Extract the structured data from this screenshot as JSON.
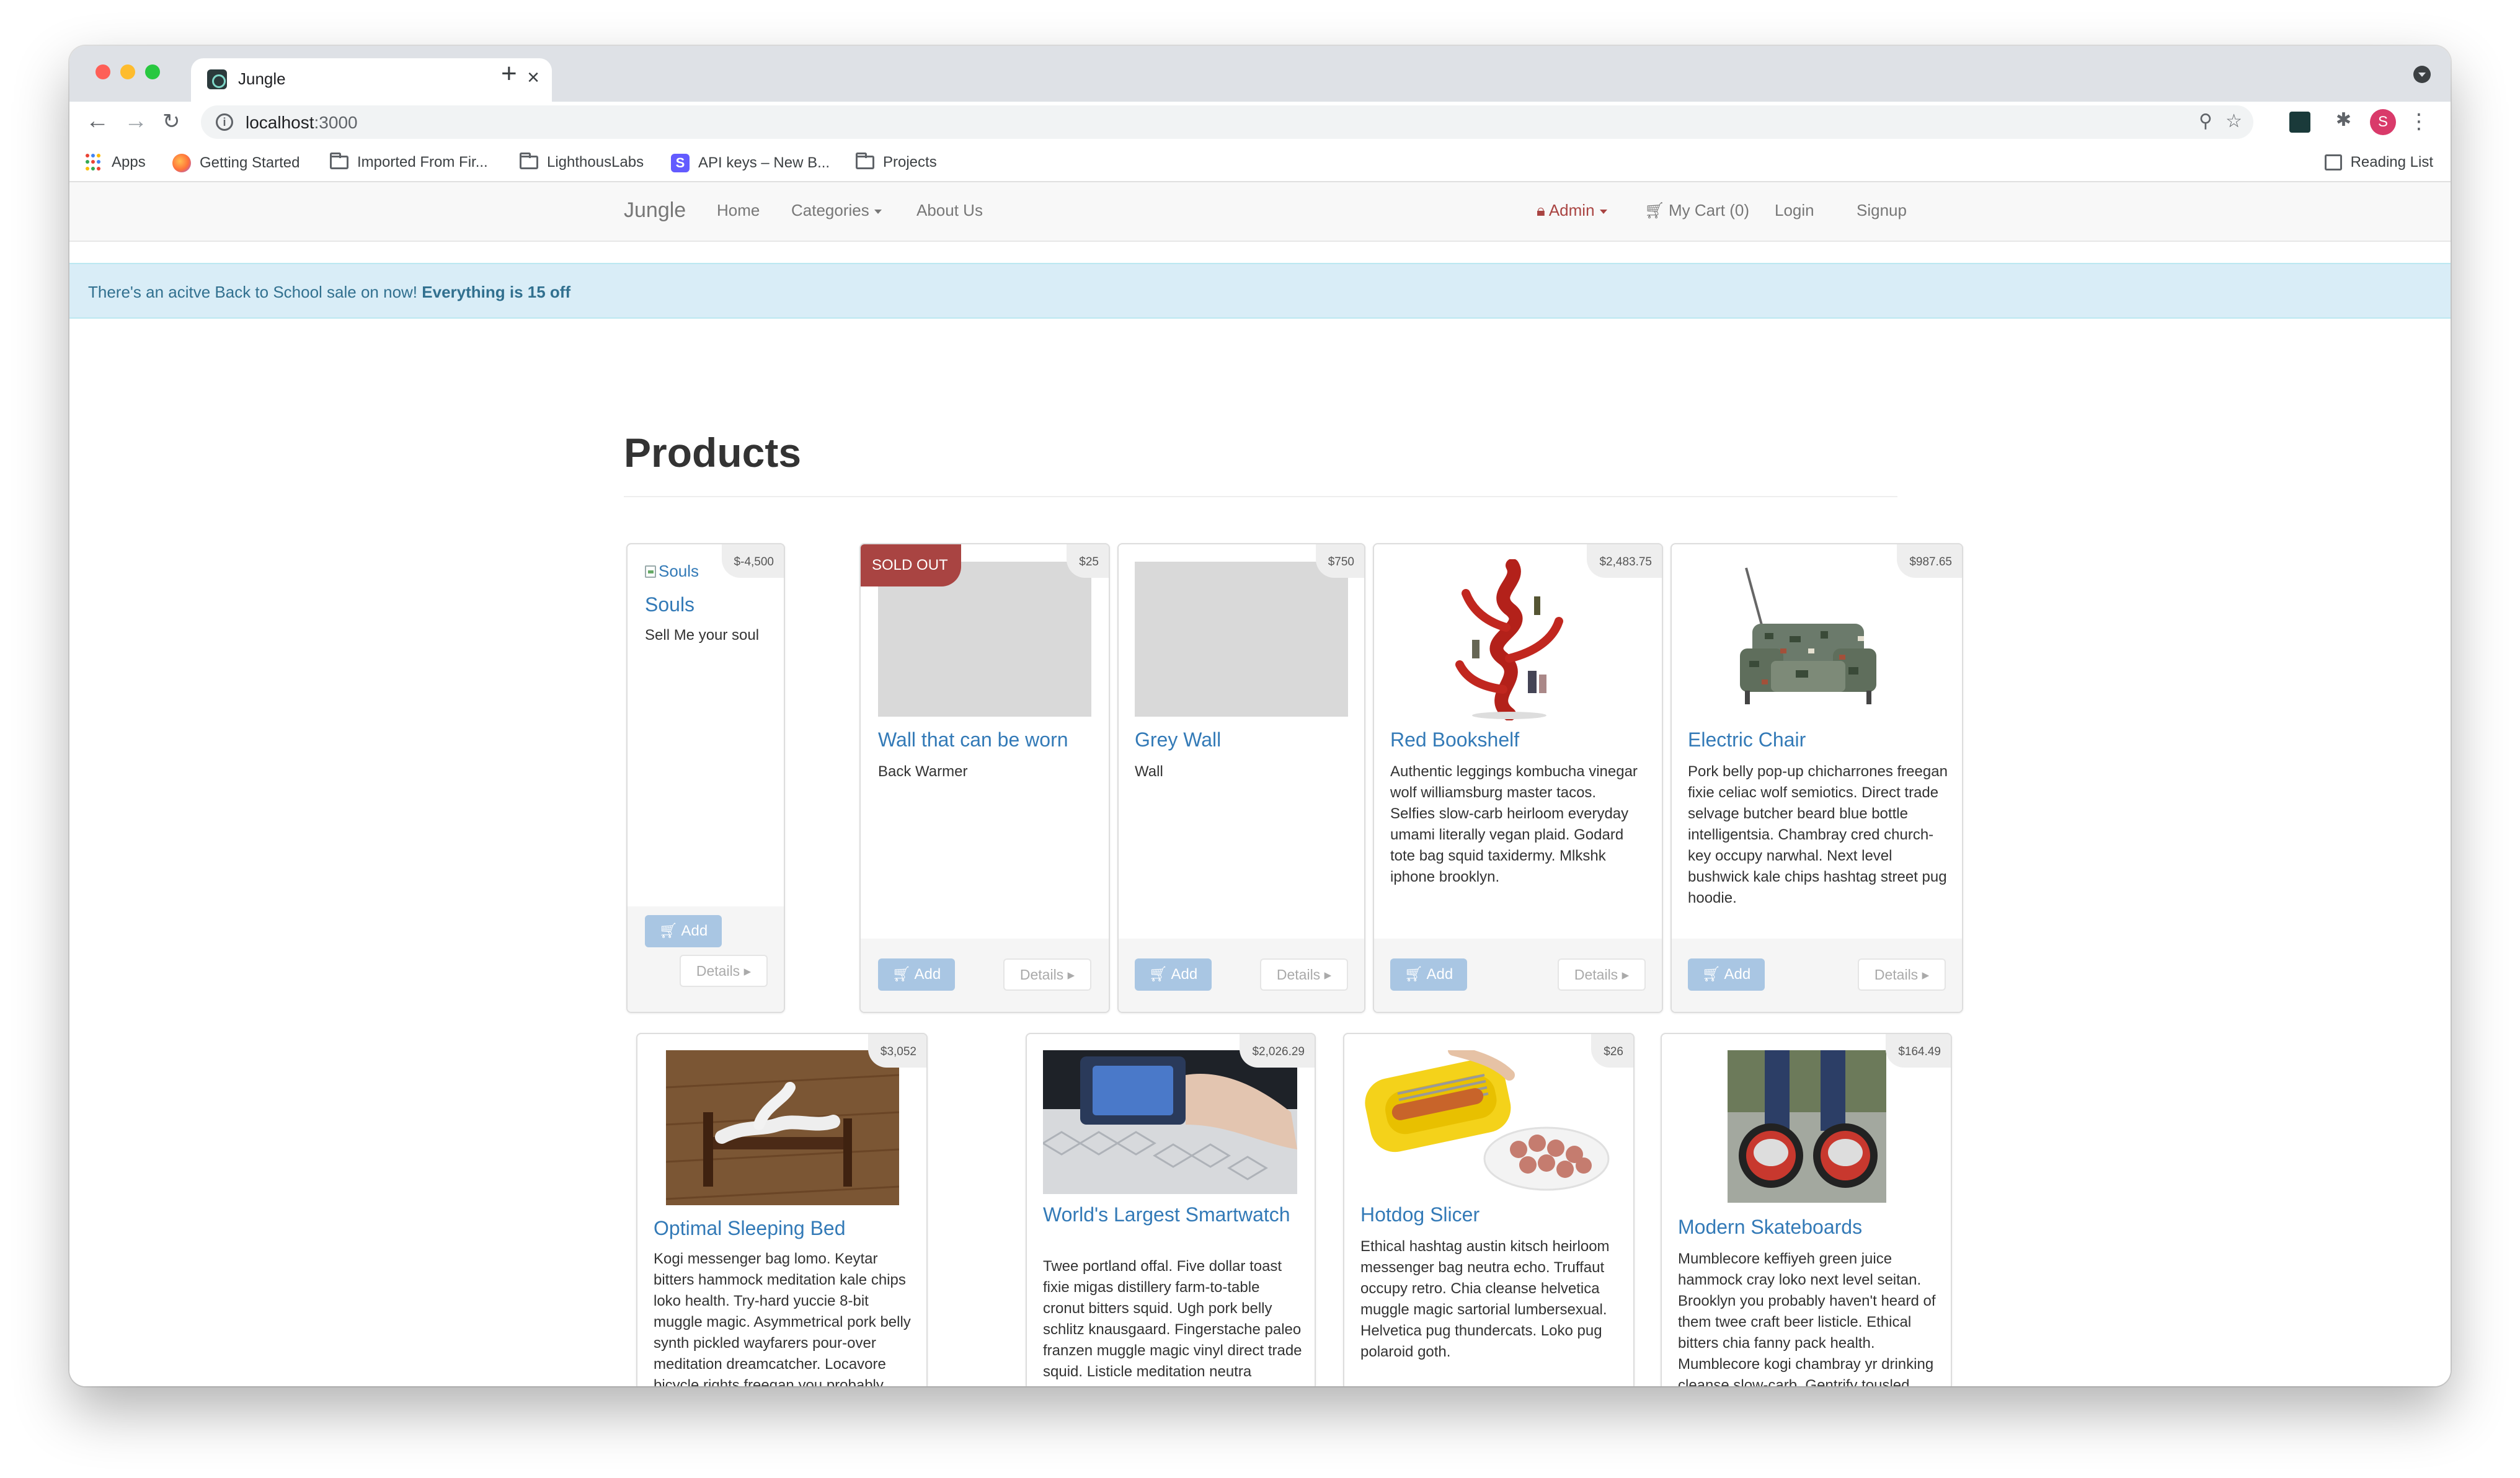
{
  "browser": {
    "tab_title": "Jungle",
    "url_host": "localhost",
    "url_port": ":3000",
    "bookmarks": [
      "Apps",
      "Getting Started",
      "Imported From Fir...",
      "LighthousLabs",
      "API keys – New B...",
      "Projects"
    ],
    "reading_list": "Reading List",
    "profile_initial": "S"
  },
  "nav": {
    "brand": "Jungle",
    "home": "Home",
    "categories": "Categories",
    "about": "About Us",
    "admin": "Admin",
    "cart": "My Cart (0)",
    "login": "Login",
    "signup": "Signup"
  },
  "alert": {
    "text": "There's an acitve Back to School sale on now! ",
    "bold": "Everything is 15 off"
  },
  "page": {
    "title": "Products"
  },
  "buttons": {
    "add": "Add",
    "details": "Details"
  },
  "products": [
    {
      "name": "Souls",
      "price": "$-4,500",
      "description": "Sell Me your soul",
      "image_alt": "Souls",
      "sold_out": false
    },
    {
      "name": "Wall that can be worn",
      "price": "$25",
      "description": "Back Warmer",
      "sold_out": true,
      "sold_out_label": "SOLD OUT"
    },
    {
      "name": "Grey Wall",
      "price": "$750",
      "description": "Wall",
      "sold_out": false
    },
    {
      "name": "Red Bookshelf",
      "price": "$2,483.75",
      "description": "Authentic leggings kombucha vinegar wolf williamsburg master tacos. Selfies slow-carb heirloom everyday umami literally vegan plaid. Godard tote bag squid taxidermy. Mlkshk iphone brooklyn.",
      "sold_out": false
    },
    {
      "name": "Electric Chair",
      "price": "$987.65",
      "description": "Pork belly pop-up chicharrones freegan fixie celiac wolf semiotics. Direct trade selvage butcher beard blue bottle intelligentsia. Chambray cred church-key occupy narwhal. Next level bushwick kale chips hashtag street pug hoodie.",
      "sold_out": false
    },
    {
      "name": "Optimal Sleeping Bed",
      "price": "$3,052",
      "description": "Kogi messenger bag lomo. Keytar bitters hammock meditation kale chips loko health. Try-hard yuccie 8-bit muggle magic. Asymmetrical pork belly synth pickled wayfarers pour-over meditation dreamcatcher. Locavore bicycle rights freegan you probably haven't heard of them.",
      "sold_out": false
    },
    {
      "name": "World's Largest Smartwatch",
      "price": "$2,026.29",
      "description": "Twee portland offal. Five dollar toast fixie migas distillery farm-to-table cronut bitters squid. Ugh pork belly schlitz knausgaard. Fingerstache paleo franzen muggle magic vinyl direct trade squid. Listicle meditation neutra letterpress. Kale chips lumbersexual vinyl gentrify",
      "sold_out": false
    },
    {
      "name": "Hotdog Slicer",
      "price": "$26",
      "description": "Ethical hashtag austin kitsch heirloom messenger bag neutra echo. Truffaut occupy retro. Chia cleanse helvetica muggle magic sartorial lumbersexual. Helvetica pug thundercats. Loko pug polaroid goth.",
      "sold_out": false
    },
    {
      "name": "Modern Skateboards",
      "price": "$164.49",
      "description": "Mumblecore keffiyeh green juice hammock cray loko next level seitan. Brooklyn you probably haven't heard of them twee craft beer listicle. Ethical bitters chia fanny pack health. Mumblecore kogi chambray yr drinking cleanse slow-carb. Gentrify tousled crucifix authentic",
      "sold_out": false
    }
  ],
  "colors": {
    "link": "#337ab7",
    "alert_bg": "#d9edf7",
    "alert_text": "#31708f",
    "sold_out": "#a94442",
    "add_button": "#a9c6e3"
  }
}
